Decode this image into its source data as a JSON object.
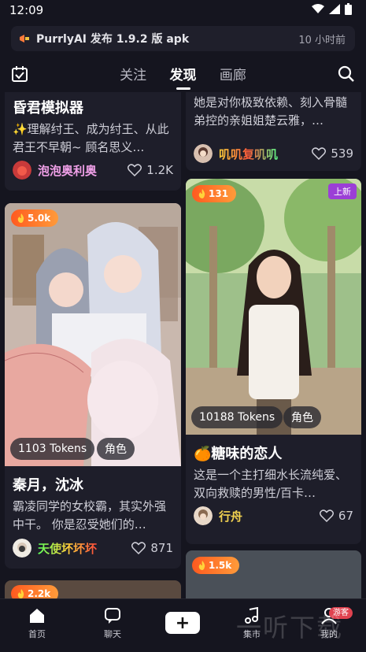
{
  "status": {
    "time": "12:09"
  },
  "notice": {
    "text": "PurrlyAI 发布 1.9.2 版 apk",
    "ago": "10 小时前"
  },
  "topnav": {
    "tabs": [
      "关注",
      "发现",
      "画廊"
    ],
    "active": "发现"
  },
  "cards": {
    "c1": {
      "title": "昏君模拟器",
      "desc": "✨理解纣王、成为纣王、从此君王不早朝~ 顾名思义…",
      "author": "泡泡奥利奥",
      "likes": "1.2K"
    },
    "c2": {
      "desc": "她是对你极致依赖、刻入骨髓弟控的亲姐姐楚云雅，…",
      "author": "叽叽复叽叽",
      "likes": "539"
    },
    "c3": {
      "hot": "5.0k",
      "tokens": "1103 Tokens",
      "role": "角色",
      "title": "秦月，沈冰",
      "desc": "霸凌同学的女校霸，其实外强中干。 你是忍受她们的…",
      "author": "天使坏坏坏",
      "likes": "871"
    },
    "c4": {
      "hot": "131",
      "new": "上新",
      "tokens": "10188 Tokens",
      "role": "角色",
      "title": "🍊糖味的恋人",
      "desc": "这是一个主打细水长流纯爱、双向救赎的男性/百卡…",
      "author": "行舟",
      "likes": "67"
    },
    "c5": {
      "hot": "2.2k"
    },
    "c6": {
      "hot": "1.5k"
    }
  },
  "bottomnav": {
    "home": "首页",
    "chat": "聊天",
    "music": "集市",
    "me": "我的",
    "guest": "游客"
  },
  "watermark": "一听下载",
  "colors": {
    "hot": "#ff6a24",
    "author1": "#f0a0e8",
    "author2": "#f0a040",
    "author3": "#f06a3a",
    "author4": "#f0d050"
  }
}
